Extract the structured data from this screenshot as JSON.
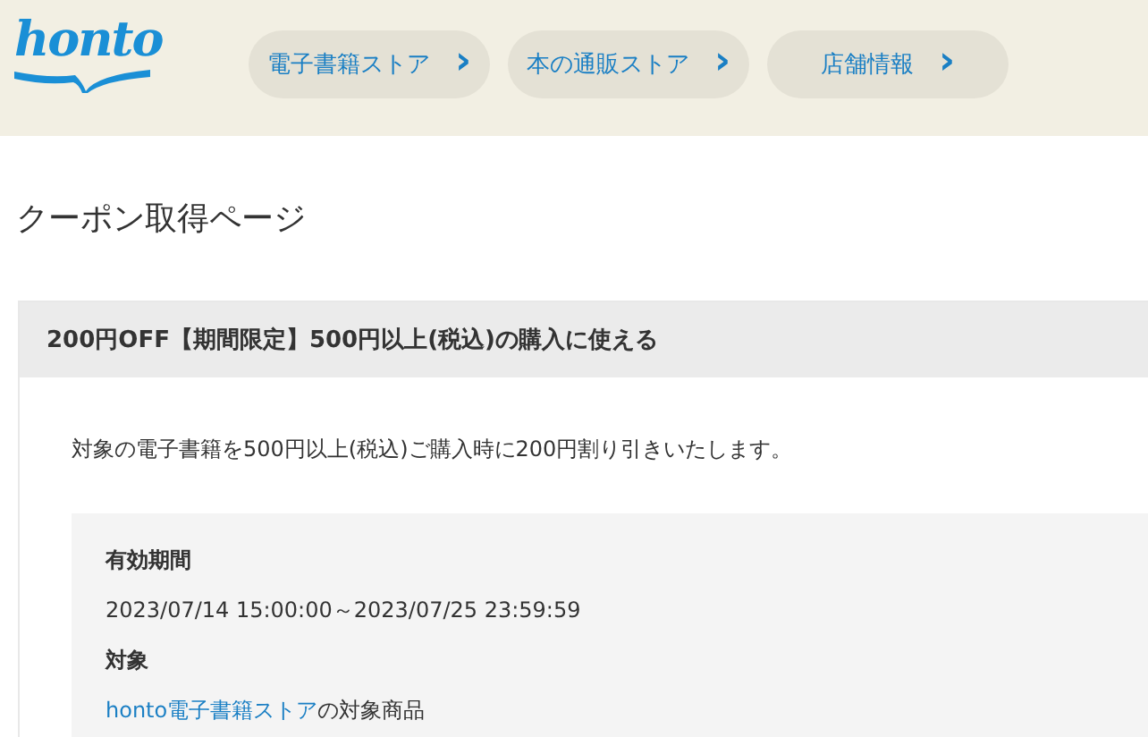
{
  "header": {
    "logo": "honto",
    "nav": [
      {
        "label": "電子書籍ストア",
        "icon": "›"
      },
      {
        "label": "本の通販ストア",
        "icon": "›"
      },
      {
        "label": "店舗情報",
        "icon": "›"
      }
    ]
  },
  "page_title": "クーポン取得ページ",
  "coupon": {
    "title": "200円OFF【期間限定】500円以上(税込)の購入に使える",
    "description": "対象の電子書籍を500円以上(税込)ご購入時に200円割り引きいたします。",
    "details": [
      {
        "kind": "text",
        "label": "有効期間",
        "value": "2023/07/14 15:00:00～2023/07/25 23:59:59"
      },
      {
        "kind": "link",
        "label": "対象",
        "link": "honto電子書籍ストア",
        "value": "の対象商品"
      }
    ]
  }
}
